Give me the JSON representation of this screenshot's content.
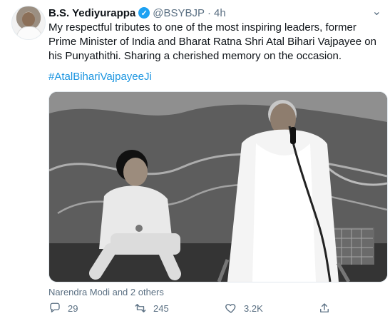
{
  "tweet": {
    "name": "B.S. Yediyurappa",
    "handle": "@BSYBJP",
    "separator": "·",
    "time": "4h",
    "text": "My respectful tributes to one of the most inspiring leaders, former Prime Minister of India and Bharat Ratna Shri Atal Bihari Vajpayee on his Punyathithi. Sharing a cherished memory on the occasion.",
    "hashtag": "#AtalBihariVajpayeeJi",
    "tagged": "Narendra Modi and 2 others",
    "icons": {
      "verified": "verified-badge-icon",
      "menu": "chevron-down-icon",
      "reply": "reply-icon",
      "retweet": "retweet-icon",
      "like": "like-icon",
      "share": "share-icon"
    },
    "stats": {
      "replies": "29",
      "retweets": "245",
      "likes": "3.2K"
    }
  },
  "colors": {
    "primary_text": "#0f1419",
    "secondary_text": "#5b7083",
    "link": "#1b95e0",
    "verified": "#1da1f2"
  }
}
